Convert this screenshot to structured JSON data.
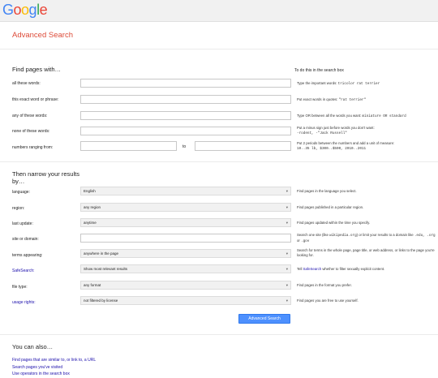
{
  "header": {
    "logo": [
      "G",
      "o",
      "o",
      "g",
      "l",
      "e"
    ],
    "logo_colors": [
      "#4285f4",
      "#ea4335",
      "#fbbc05",
      "#4285f4",
      "#34a853",
      "#ea4335"
    ]
  },
  "page_title": "Advanced Search",
  "find": {
    "heading": "Find pages with…",
    "col_head": "To do this in the search box",
    "rows": [
      {
        "label": "all these words:",
        "hint_pre": "Type the important words: ",
        "hint_code": "tricolor rat terrier"
      },
      {
        "label": "this exact word or phrase:",
        "hint_pre": "Put exact words in quotes: ",
        "hint_code": "\"rat terrier\""
      },
      {
        "label": "any of these words:",
        "hint_pre": "Type OR between all the words you want: ",
        "hint_code": "miniature OR standard"
      },
      {
        "label": "none of these words:",
        "hint_pre": "Put a minus sign just before words you don't want:",
        "hint_code": "-rodent, -\"Jack Russell\""
      },
      {
        "label": "numbers ranging from:",
        "to": "to",
        "hint_pre": "Put 2 periods between the numbers and add a unit of measure:",
        "hint_code": "10..35 lb, $300..$500, 2010..2011"
      }
    ]
  },
  "narrow": {
    "heading": "Then narrow your results by…",
    "rows": [
      {
        "label": "language:",
        "value": "English",
        "hint": "Find pages in the language you select."
      },
      {
        "label": "region:",
        "value": "any region",
        "hint": "Find pages published in a particular region."
      },
      {
        "label": "last update:",
        "value": "anytime",
        "hint": "Find pages updated within the time you specify."
      },
      {
        "label": "site or domain:",
        "hint_pre": "Search one site (like ",
        "hint_code1": "wikipedia.org",
        "hint_mid": ") or limit your results to a domain like ",
        "hint_code2": ".edu, .org",
        "hint_or": " or ",
        "hint_code3": ".gov"
      },
      {
        "label": "terms appearing:",
        "value": "anywhere in the page",
        "hint": "Search for terms in the whole page, page title, or web address, or links to the page you're looking for."
      },
      {
        "label": "SafeSearch:",
        "value": "Show most relevant results",
        "hint_pre": "Tell ",
        "hint_link": "SafeSearch",
        "hint_post": " whether to filter sexually explicit content."
      },
      {
        "label": "file type:",
        "value": "any format",
        "hint": "Find pages in the format you prefer."
      },
      {
        "label": "usage rights:",
        "value": "not filtered by license",
        "hint": "Find pages you are free to use yourself."
      }
    ]
  },
  "submit_label": "Advanced Search",
  "also": {
    "heading": "You can also…",
    "links": [
      "Find pages that are similar to, or link to, a URL",
      "Search pages you've visited",
      "Use operators in the search box"
    ]
  },
  "colors": {
    "accent": "#dd4b39",
    "link": "#1a0dab",
    "button": "#4d90fe"
  },
  "icons": {
    "dropdown": "chevron-down-icon"
  }
}
